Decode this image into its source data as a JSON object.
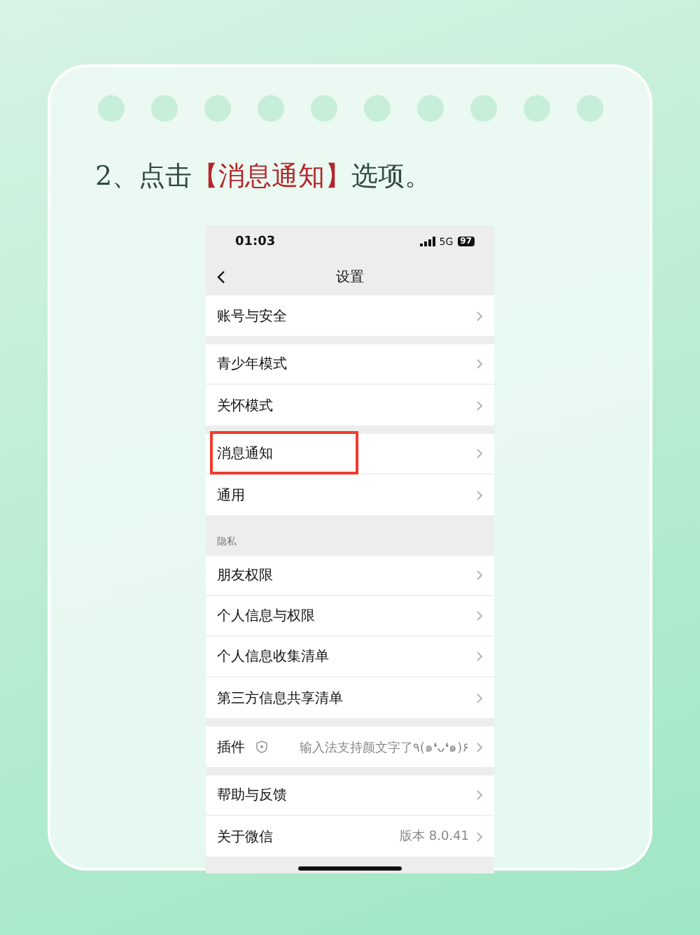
{
  "instruction": [
    {
      "text": "2、点击",
      "highlight": false
    },
    {
      "text": "【消息通知】",
      "highlight": true
    },
    {
      "text": "选项。",
      "highlight": false
    }
  ],
  "phone": {
    "status_bar": {
      "time": "01:03",
      "network": "5G",
      "battery": "97"
    },
    "nav_title": "设置",
    "groups": [
      {
        "items": [
          {
            "kind": "plain",
            "label": "账号与安全",
            "marked": false
          }
        ]
      },
      {
        "items": [
          {
            "kind": "plain",
            "label": "青少年模式",
            "marked": false
          },
          {
            "kind": "plain",
            "label": "关怀模式",
            "marked": false
          }
        ]
      },
      {
        "items": [
          {
            "kind": "plain",
            "label": "消息通知",
            "marked": true
          },
          {
            "kind": "plain",
            "label": "通用",
            "marked": false
          }
        ]
      },
      {
        "header": "隐私",
        "items": [
          {
            "kind": "plain",
            "label": "朋友权限",
            "marked": false
          },
          {
            "kind": "plain",
            "label": "个人信息与权限",
            "marked": false
          },
          {
            "kind": "plain",
            "label": "个人信息收集清单",
            "marked": false
          },
          {
            "kind": "plain",
            "label": "第三方信息共享清单",
            "marked": false
          }
        ]
      },
      {
        "items": [
          {
            "kind": "icon",
            "label": "插件",
            "value": "输入法支持颜文字了٩(๑❛ᴗ❛๑)۶",
            "marked": false
          }
        ]
      },
      {
        "items": [
          {
            "kind": "plain",
            "label": "帮助与反馈",
            "marked": false
          },
          {
            "kind": "plain",
            "label": "关于微信",
            "value": "版本 8.0.41",
            "marked": false
          }
        ]
      }
    ]
  }
}
